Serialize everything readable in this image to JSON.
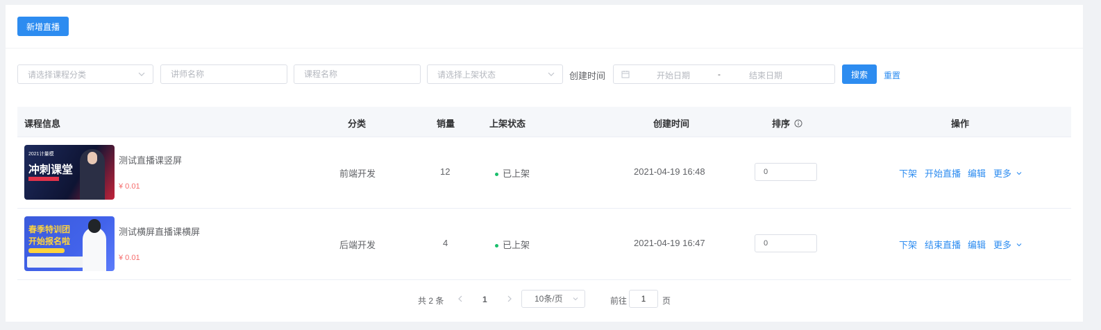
{
  "toolbar": {
    "add_live_label": "新增直播"
  },
  "filters": {
    "category_placeholder": "请选择课程分类",
    "teacher_placeholder": "讲师名称",
    "course_placeholder": "课程名称",
    "status_placeholder": "请选择上架状态",
    "created_label": "创建时间",
    "date_start_placeholder": "开始日期",
    "date_separator": "-",
    "date_end_placeholder": "结束日期",
    "search_label": "搜索",
    "reset_label": "重置"
  },
  "table": {
    "columns": [
      "课程信息",
      "分类",
      "销量",
      "上架状态",
      "创建时间",
      "排序",
      "操作"
    ],
    "rows": [
      {
        "thumb_text": "冲刺课堂",
        "thumb_sub": "2021计量模",
        "name": "测试直播课竖屏",
        "price": "¥ 0.01",
        "category": "前端开发",
        "sales": "12",
        "status": "已上架",
        "created": "2021-04-19 16:48",
        "sort": "0",
        "ops": [
          "下架",
          "开始直播",
          "编辑",
          "更多"
        ]
      },
      {
        "thumb_text": "春季特训团",
        "thumb_sub": "开始报名啦",
        "name": "测试横屏直播课横屏",
        "price": "¥ 0.01",
        "category": "后端开发",
        "sales": "4",
        "status": "已上架",
        "created": "2021-04-19 16:47",
        "sort": "0",
        "ops": [
          "下架",
          "结束直播",
          "编辑",
          "更多"
        ]
      }
    ]
  },
  "pagination": {
    "total": "共 2 条",
    "current_page": "1",
    "page_size": "10条/页",
    "goto_label": "前往",
    "goto_value": "1",
    "page_suffix": "页"
  },
  "colors": {
    "primary": "#2d8cf0",
    "price": "#f56c6c",
    "status_dot": "#19be6b"
  }
}
